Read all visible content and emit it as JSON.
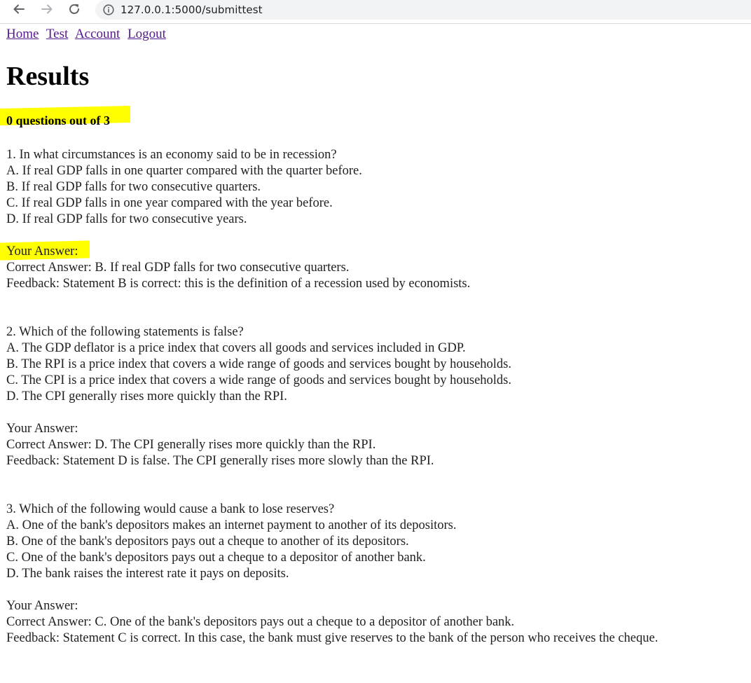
{
  "browser": {
    "url": "127.0.0.1:5000/submittest"
  },
  "nav": {
    "links": [
      "Home",
      "Test",
      "Account",
      "Logout"
    ]
  },
  "page": {
    "title": "Results",
    "score": "0 questions out of 3"
  },
  "questions": [
    {
      "question": "1. In what circumstances is an economy said to be in recession?",
      "options": [
        "A. If real GDP falls in one quarter compared with the quarter before.",
        "B. If real GDP falls for two consecutive quarters.",
        "C. If real GDP falls in one year compared with the year before.",
        "D. If real GDP falls for two consecutive years."
      ],
      "your_answer": "Your Answer:",
      "correct_answer": "Correct Answer: B. If real GDP falls for two consecutive quarters.",
      "feedback": "Feedback: Statement B is correct: this is the definition of a recession used by economists."
    },
    {
      "question": "2. Which of the following statements is false?",
      "options": [
        "A. The GDP deflator is a price index that covers all goods and services included in GDP.",
        "B. The RPI is a price index that covers a wide range of goods and services bought by households.",
        "C. The CPI is a price index that covers a wide range of goods and services bought by households.",
        "D. The CPI generally rises more quickly than the RPI."
      ],
      "your_answer": "Your Answer:",
      "correct_answer": "Correct Answer: D. The CPI generally rises more quickly than the RPI.",
      "feedback": "Feedback: Statement D is false. The CPI generally rises more slowly than the RPI."
    },
    {
      "question": "3. Which of the following would cause a bank to lose reserves?",
      "options": [
        "A. One of the bank's depositors makes an internet payment to another of its depositors.",
        "B. One of the bank's depositors pays out a cheque to another of its depositors.",
        "C. One of the bank's depositors pays out a cheque to a depositor of another bank.",
        "D. The bank raises the interest rate it pays on deposits."
      ],
      "your_answer": "Your Answer:",
      "correct_answer": "Correct Answer: C. One of the bank's depositors pays out a cheque to a depositor of another bank.",
      "feedback": "Feedback: Statement C is correct. In this case, the bank must give reserves to the bank of the person who receives the cheque."
    }
  ],
  "colors": {
    "highlight": "#ffff00",
    "visited_link": "#551a8b",
    "omnibox_bg": "#f1f3f4"
  },
  "icons": [
    "back-arrow-icon",
    "forward-arrow-icon",
    "reload-icon",
    "info-icon"
  ]
}
